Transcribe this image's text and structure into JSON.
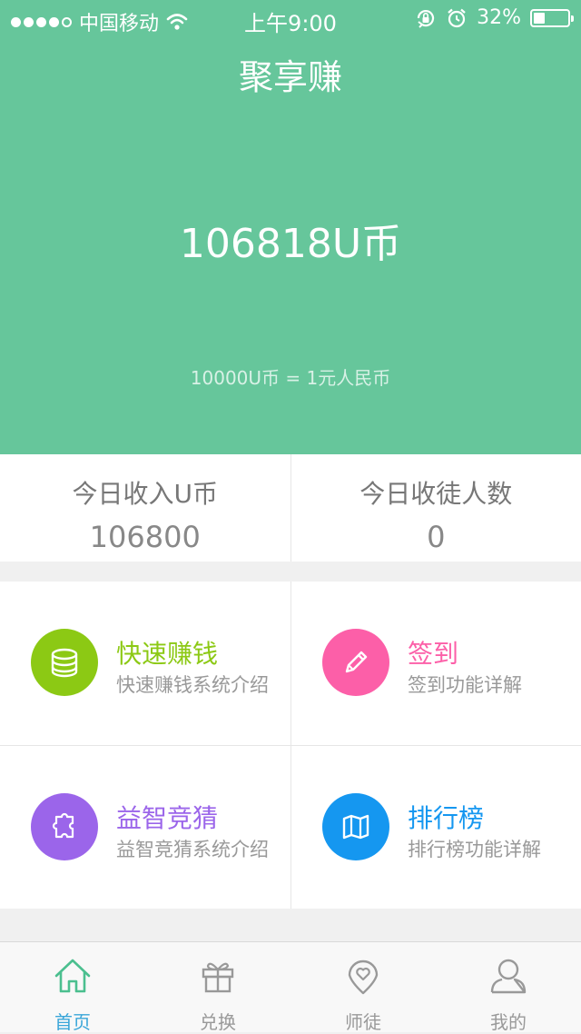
{
  "status_bar": {
    "carrier": "中国移动",
    "time": "上午9:00",
    "battery_percent": "32%",
    "battery_level": 0.32,
    "signal_bars": 4
  },
  "header": {
    "title": "聚享赚",
    "balance": "106818U币",
    "rate_note": "10000U币 = 1元人民币"
  },
  "stats": [
    {
      "label": "今日收入U币",
      "value": "106800"
    },
    {
      "label": "今日收徒人数",
      "value": "0"
    }
  ],
  "features": [
    {
      "title": "快速赚钱",
      "subtitle": "快速赚钱系统介绍",
      "color": "#8cc914",
      "icon": "coin-stack-icon"
    },
    {
      "title": "签到",
      "subtitle": "签到功能详解",
      "color": "#fc5fa8",
      "icon": "pencil-icon"
    },
    {
      "title": "益智竞猜",
      "subtitle": "益智竞猜系统介绍",
      "color": "#9b65ea",
      "icon": "puzzle-icon"
    },
    {
      "title": "排行榜",
      "subtitle": "排行榜功能详解",
      "color": "#1597f0",
      "icon": "map-icon"
    }
  ],
  "tabs": [
    {
      "label": "首页",
      "icon": "home-icon",
      "active": true
    },
    {
      "label": "兑换",
      "icon": "gift-icon",
      "active": false
    },
    {
      "label": "师徒",
      "icon": "heart-pin-icon",
      "active": false
    },
    {
      "label": "我的",
      "icon": "user-icon",
      "active": false
    }
  ],
  "colors": {
    "hero_bg": "#66c69b",
    "tab_active": "#3aa6d9",
    "tab_active_icon": "#4bbf8f",
    "tab_inactive": "#999999"
  }
}
